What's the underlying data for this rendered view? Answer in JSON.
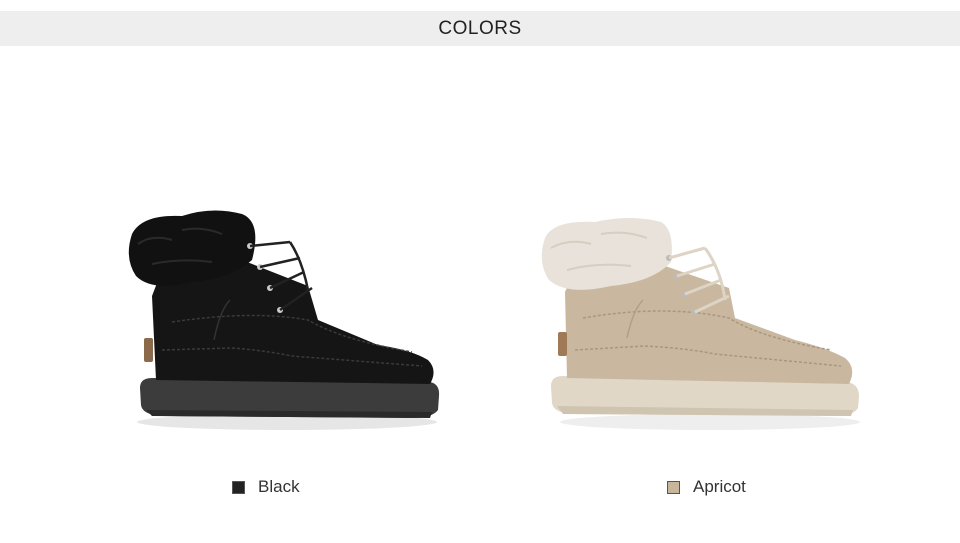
{
  "header": {
    "title": "COLORS"
  },
  "products": [
    {
      "label": "Black",
      "swatch_color": "#222222",
      "boot_color": "#151515",
      "sole_color": "#3c3c3c",
      "fur_color": "#111111"
    },
    {
      "label": "Apricot",
      "swatch_color": "#c7b59c",
      "boot_color": "#c9b89f",
      "sole_color": "#e0d7c6",
      "fur_color": "#e8e2da"
    }
  ],
  "icons": {
    "left_product": "black-boot-image",
    "right_product": "apricot-boot-image"
  }
}
